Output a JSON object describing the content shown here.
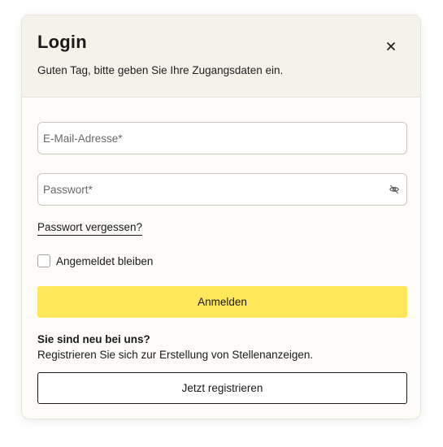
{
  "dialog": {
    "title": "Login",
    "subtitle": "Guten Tag, bitte geben Sie Ihre Zugangsdaten ein.",
    "close_icon": "close-icon"
  },
  "form": {
    "email": {
      "value": "",
      "placeholder": "E-Mail-Adresse*"
    },
    "password": {
      "value": "",
      "placeholder": "Passwort*",
      "toggle_icon": "eye-off-icon"
    },
    "forgot_password_label": "Passwort vergessen?",
    "remember_me": {
      "label": "Angemeldet bleiben",
      "checked": false
    },
    "submit_label": "Anmelden"
  },
  "register": {
    "heading": "Sie sind neu bei uns?",
    "text": "Registrieren Sie sich zur Erstellung von Stellenanzeigen.",
    "button_label": "Jetzt registrieren"
  },
  "colors": {
    "primary_button": "#ffe65a",
    "header_background": "#f5f2ea",
    "text": "#1a1a1a"
  }
}
